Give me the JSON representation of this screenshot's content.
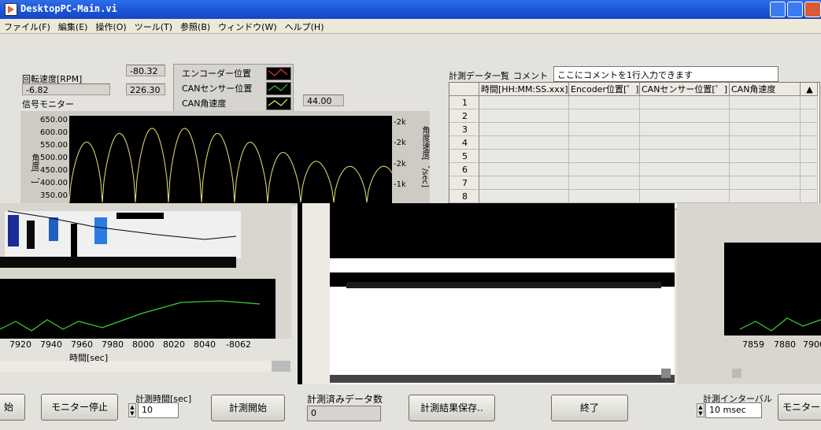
{
  "window": {
    "title": "DesktopPC-Main.vi"
  },
  "menu": [
    "ファイル(F)",
    "編集(E)",
    "操作(O)",
    "ツール(T)",
    "参照(B)",
    "ウィンドウ(W)",
    "ヘルプ(H)"
  ],
  "indicators": {
    "rpm_label": "回転速度[RPM]",
    "rpm_value": "-6.82",
    "val1": "-80.32",
    "val2": "226.30",
    "val3": "44.00",
    "monitor_label": "信号モニター"
  },
  "legend": [
    "エンコーダー位置",
    "CANセンサー位置",
    "CAN角速度"
  ],
  "chart": {
    "y_ticks_left": [
      "650.00",
      "600.00",
      "550.00",
      "500.00",
      "450.00",
      "400.00",
      "350.00"
    ],
    "y_ticks_right": [
      "-2k",
      "-2k",
      "-2k",
      "-1k"
    ],
    "ylabel_left": "角度[゜]",
    "ylabel_right": "角度速度[゜/sec]",
    "x_ticks": [
      "7920",
      "7940",
      "7960",
      "7980",
      "8000",
      "8020",
      "8040",
      "-8062"
    ],
    "xlabel": "時間[sec]",
    "x_ticks_right": [
      "7859",
      "7880",
      "7900"
    ]
  },
  "table": {
    "title": "計測データ一覧",
    "comment_label": "コメント",
    "comment_value": "ここにコメントを1行入力できます",
    "headers": [
      "時間[HH:MM:SS.xxx]",
      "Encoder位置[゜]",
      "CANセンサー位置[゜]",
      "CAN角速度"
    ],
    "rows": [
      "1",
      "2",
      "3",
      "4",
      "5",
      "6",
      "7",
      "8"
    ]
  },
  "controls": {
    "start_partial": "始",
    "monitor_stop": "モニター停止",
    "meas_time_label": "計測時間[sec]",
    "meas_time_value": "10",
    "meas_start": "計測開始",
    "count_label": "計測済みデータ数",
    "count_value": "0",
    "save": "計測結果保存..",
    "exit": "終了",
    "interval_label": "計測インターバル",
    "interval_value": "10 msec",
    "monitor_partial": "モニター"
  }
}
